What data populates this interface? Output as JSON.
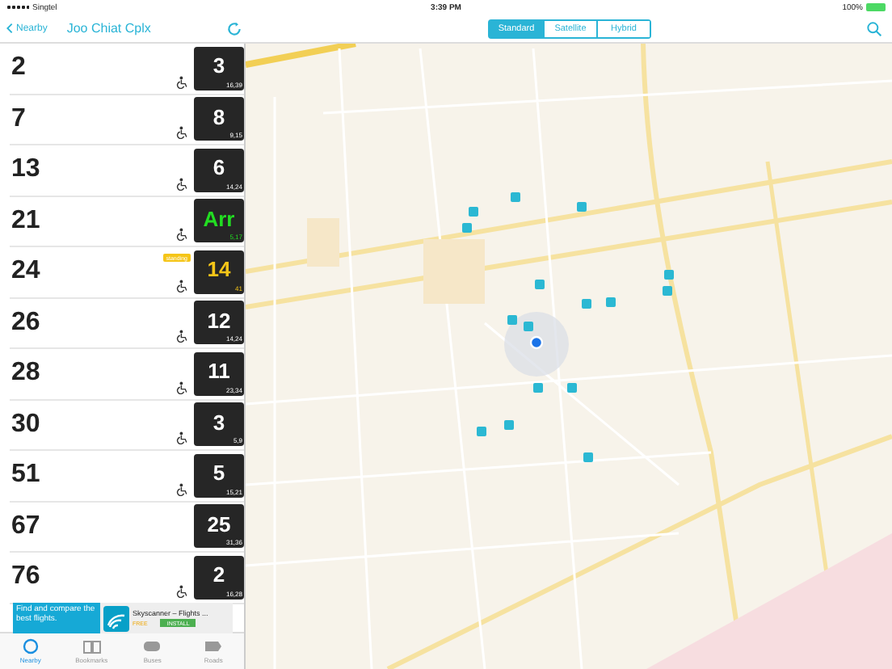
{
  "status_bar": {
    "carrier": "Singtel",
    "time": "3:39 PM",
    "battery": "100%"
  },
  "nav": {
    "back": "Nearby",
    "title": "Joo Chiat Cplx"
  },
  "map_modes": [
    {
      "label": "Standard",
      "selected": true
    },
    {
      "label": "Satellite",
      "selected": false
    },
    {
      "label": "Hybrid",
      "selected": false
    }
  ],
  "services": [
    {
      "number": "2",
      "next": "3",
      "subsequent": "16,39",
      "accessible": true,
      "color": "#ffffff"
    },
    {
      "number": "7",
      "next": "8",
      "subsequent": "9,15",
      "accessible": true,
      "color": "#ffffff"
    },
    {
      "number": "13",
      "next": "6",
      "subsequent": "14,24",
      "accessible": true,
      "color": "#ffffff"
    },
    {
      "number": "21",
      "next": "Arr",
      "subsequent": "5,17",
      "accessible": true,
      "color": "#22dd22"
    },
    {
      "number": "24",
      "next": "14",
      "subsequent": "41",
      "accessible": true,
      "color": "#f5c518",
      "badge": "standing"
    },
    {
      "number": "26",
      "next": "12",
      "subsequent": "14,24",
      "accessible": true,
      "color": "#ffffff"
    },
    {
      "number": "28",
      "next": "11",
      "subsequent": "23,34",
      "accessible": true,
      "color": "#ffffff"
    },
    {
      "number": "30",
      "next": "3",
      "subsequent": "5,9",
      "accessible": true,
      "color": "#ffffff"
    },
    {
      "number": "51",
      "next": "5",
      "subsequent": "15,21",
      "accessible": true,
      "color": "#ffffff"
    },
    {
      "number": "67",
      "next": "25",
      "subsequent": "31,36",
      "accessible": false,
      "color": "#ffffff"
    },
    {
      "number": "76",
      "next": "2",
      "subsequent": "16,28",
      "accessible": true,
      "color": "#ffffff"
    }
  ],
  "ad": {
    "text": "Find and compare the best flights.",
    "app": "Skyscanner – Flights ...",
    "price": "FREE",
    "action": "INSTALL"
  },
  "tabs": [
    {
      "label": "Nearby",
      "selected": true
    },
    {
      "label": "Bookmarks",
      "selected": false
    },
    {
      "label": "Buses",
      "selected": false
    },
    {
      "label": "Roads",
      "selected": false
    }
  ]
}
